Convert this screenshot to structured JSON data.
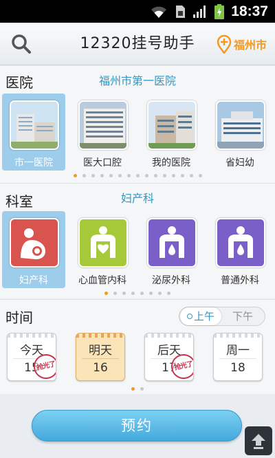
{
  "status_bar": {
    "time": "18:37",
    "icons": [
      "wifi-icon",
      "sim-icon",
      "signal-icon",
      "battery-charging-icon"
    ]
  },
  "header": {
    "title": "12320挂号助手",
    "city": "福州市",
    "search_icon": "search-icon",
    "location_icon": "location-pin-icon"
  },
  "hospital_section": {
    "title": "医院",
    "selected": "福州市第一医院",
    "items": [
      {
        "label": "市一医院"
      },
      {
        "label": "医大口腔"
      },
      {
        "label": "我的医院"
      },
      {
        "label": "省妇幼"
      }
    ],
    "page_count": 15,
    "current_page": 0
  },
  "department_section": {
    "title": "科室",
    "selected": "妇产科",
    "items": [
      {
        "label": "妇产科",
        "color": "#d9534f",
        "icon": "mother-child-icon"
      },
      {
        "label": "心血管内科",
        "color": "#a6c93a",
        "icon": "heart-body-icon"
      },
      {
        "label": "泌尿外科",
        "color": "#7b5fc9",
        "icon": "kidney-body-icon"
      },
      {
        "label": "普通外科",
        "color": "#7b5fc9",
        "icon": "body-icon"
      }
    ],
    "page_count": 8,
    "current_page": 0
  },
  "time_section": {
    "title": "时间",
    "am_label": "上午",
    "pm_label": "下午",
    "selected_period": "上午",
    "days": [
      {
        "name": "今天",
        "date": "15",
        "stamp": "抢光了"
      },
      {
        "name": "明天",
        "date": "16",
        "stamp": ""
      },
      {
        "name": "后天",
        "date": "17",
        "stamp": "抢光了"
      },
      {
        "name": "周一",
        "date": "18",
        "stamp": ""
      }
    ],
    "page_count": 2,
    "current_page": 0
  },
  "actions": {
    "book_label": "预约",
    "scroll_top_icon": "arrow-up-icon"
  },
  "colors": {
    "accent": "#2f98c6",
    "orange": "#f39a1e",
    "button": "#44a9de"
  }
}
